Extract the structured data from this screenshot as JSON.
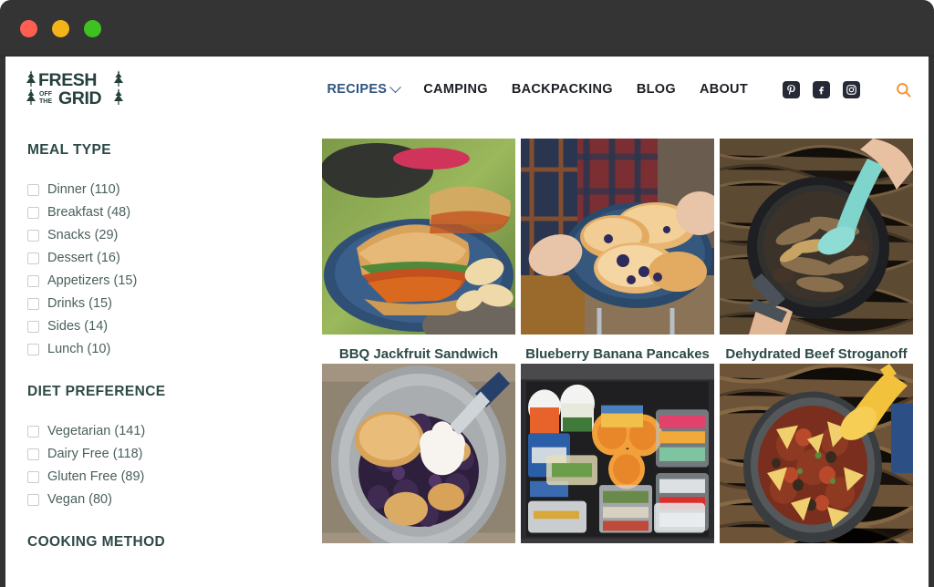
{
  "window": {
    "traffic_lights": [
      "close",
      "minimize",
      "maximize"
    ],
    "colors": {
      "close": "#ff5f52",
      "minimize": "#f2b418",
      "maximize": "#3ec221",
      "chrome": "#343434"
    }
  },
  "site": {
    "logo_text_top": "FRESH",
    "logo_text_mid": "OFF THE",
    "logo_text_bottom": "GRID",
    "logo_name": "Fresh Off The Grid"
  },
  "nav": {
    "items": [
      {
        "label": "RECIPES",
        "active": true,
        "has_dropdown": true
      },
      {
        "label": "CAMPING",
        "active": false,
        "has_dropdown": false
      },
      {
        "label": "BACKPACKING",
        "active": false,
        "has_dropdown": false
      },
      {
        "label": "BLOG",
        "active": false,
        "has_dropdown": false
      },
      {
        "label": "ABOUT",
        "active": false,
        "has_dropdown": false
      }
    ],
    "active_color": "#2f5480",
    "default_color": "#1d1f26",
    "social": [
      {
        "name": "pinterest-icon",
        "glyph": "P"
      },
      {
        "name": "facebook-icon",
        "glyph": "f"
      },
      {
        "name": "instagram-icon",
        "glyph": "◉"
      }
    ],
    "search_icon_color": "#f5912d"
  },
  "sidebar": {
    "groups": [
      {
        "title": "MEAL TYPE",
        "options": [
          {
            "label": "Dinner (110)",
            "checked": false
          },
          {
            "label": "Breakfast (48)",
            "checked": false
          },
          {
            "label": "Snacks (29)",
            "checked": false
          },
          {
            "label": "Dessert (16)",
            "checked": false
          },
          {
            "label": "Appetizers (15)",
            "checked": false
          },
          {
            "label": "Drinks (15)",
            "checked": false
          },
          {
            "label": "Sides (14)",
            "checked": false
          },
          {
            "label": "Lunch (10)",
            "checked": false
          }
        ]
      },
      {
        "title": "DIET PREFERENCE",
        "options": [
          {
            "label": "Vegetarian (141)",
            "checked": false
          },
          {
            "label": "Dairy Free (118)",
            "checked": false
          },
          {
            "label": "Gluten Free (89)",
            "checked": false
          },
          {
            "label": "Vegan (80)",
            "checked": false
          }
        ]
      },
      {
        "title": "COOKING METHOD",
        "options": []
      }
    ],
    "heading_color": "#2d4a47"
  },
  "recipes": {
    "row1": [
      {
        "title": "BBQ Jackfruit Sandwich",
        "image": "bbq-jackfruit-sandwich-on-blue-plate-with-chips"
      },
      {
        "title": "Blueberry Banana Pancakes",
        "image": "hands-holding-plate-of-blueberry-pancakes"
      },
      {
        "title": "Dehydrated Beef Stroganoff",
        "image": "beef-stroganoff-in-camp-pot-with-teal-spoon"
      }
    ],
    "row2": [
      {
        "title": "",
        "image": "blueberry-cobbler-in-skillet-with-whipped-cream"
      },
      {
        "title": "",
        "image": "camp-food-storage-box-with-snacks-and-oranges"
      },
      {
        "title": "",
        "image": "chili-with-corn-chips-in-camp-pot-with-yellow-spoon"
      }
    ]
  }
}
